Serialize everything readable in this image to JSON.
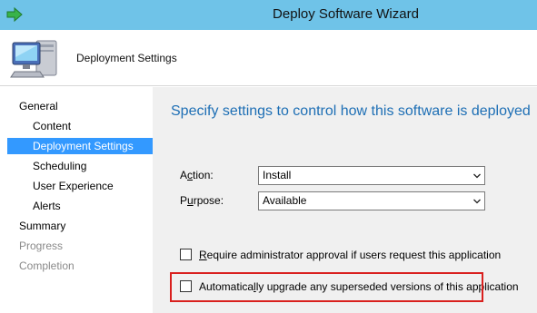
{
  "window": {
    "title": "Deploy Software Wizard",
    "title_bar_color": "#6fc3e8"
  },
  "header": {
    "title": "Deployment Settings",
    "icon": "computer-icon"
  },
  "nav": {
    "items": [
      {
        "label": "General",
        "level": 0,
        "state": "normal"
      },
      {
        "label": "Content",
        "level": 1,
        "state": "normal"
      },
      {
        "label": "Deployment Settings",
        "level": 1,
        "state": "selected"
      },
      {
        "label": "Scheduling",
        "level": 1,
        "state": "normal"
      },
      {
        "label": "User Experience",
        "level": 1,
        "state": "normal"
      },
      {
        "label": "Alerts",
        "level": 1,
        "state": "normal"
      },
      {
        "label": "Summary",
        "level": 0,
        "state": "normal"
      },
      {
        "label": "Progress",
        "level": 0,
        "state": "disabled"
      },
      {
        "label": "Completion",
        "level": 0,
        "state": "disabled"
      }
    ],
    "selected_color": "#3399ff"
  },
  "main": {
    "heading": "Specify settings to control how this software is deployed",
    "heading_color": "#1e6fb5",
    "action": {
      "label_prefix": "A",
      "label_accel": "c",
      "label_suffix": "tion:",
      "value": "Install"
    },
    "purpose": {
      "label_prefix": "P",
      "label_accel": "u",
      "label_suffix": "rpose:",
      "value": "Available"
    },
    "require_approval": {
      "accel": "R",
      "label_rest": "equire administrator approval if users request this application",
      "checked": false
    },
    "auto_upgrade": {
      "prefix": "Automatica",
      "accel": "l",
      "suffix": "ly upgrade any superseded versions of this application",
      "checked": false,
      "highlight_color": "#d9201e"
    }
  }
}
